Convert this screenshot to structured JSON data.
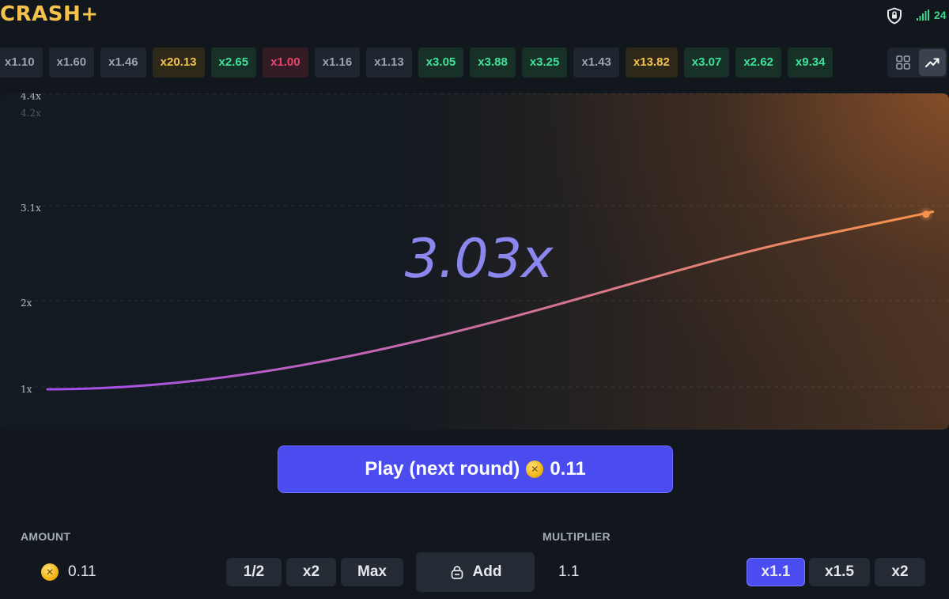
{
  "header": {
    "logo": "CRASH+",
    "ping": "24",
    "icons": {
      "shield": "shield-icon",
      "signal": "signal-bars-icon"
    }
  },
  "history": [
    {
      "label": "x1.10",
      "tone": "grey"
    },
    {
      "label": "x1.60",
      "tone": "grey"
    },
    {
      "label": "x1.46",
      "tone": "grey"
    },
    {
      "label": "x20.13",
      "tone": "gold"
    },
    {
      "label": "x2.65",
      "tone": "green"
    },
    {
      "label": "x1.00",
      "tone": "red"
    },
    {
      "label": "x1.16",
      "tone": "grey"
    },
    {
      "label": "x1.13",
      "tone": "grey"
    },
    {
      "label": "x3.05",
      "tone": "green"
    },
    {
      "label": "x3.88",
      "tone": "green"
    },
    {
      "label": "x3.25",
      "tone": "green"
    },
    {
      "label": "x1.43",
      "tone": "grey"
    },
    {
      "label": "x13.82",
      "tone": "gold"
    },
    {
      "label": "x3.07",
      "tone": "green"
    },
    {
      "label": "x2.62",
      "tone": "green"
    },
    {
      "label": "x9.34",
      "tone": "green"
    }
  ],
  "view_toggle": {
    "grid_icon": "grid-icon",
    "chart_icon": "trend-chart-icon",
    "selected": "chart"
  },
  "game": {
    "current_multiplier": "3.03x",
    "y_ticks": [
      "1x",
      "2x",
      "3.1x",
      "4.2x",
      "4.4x"
    ],
    "y_tick_values": [
      1,
      2,
      3.1,
      4.2,
      4.4
    ],
    "curve_end": 3.03,
    "colors": {
      "curve_start": "#a24df0",
      "curve_end": "#f7934a",
      "accent": "#4a4cf0"
    }
  },
  "play_button": {
    "label": "Play (next round)",
    "amount": "0.11"
  },
  "amount": {
    "label": "AMOUNT",
    "value": "0.11",
    "half": "1/2",
    "double": "x2",
    "max": "Max",
    "add": "Add"
  },
  "multiplier": {
    "label": "MULTIPLIER",
    "value": "1.1",
    "presets": [
      "x1.1",
      "x1.5",
      "x2"
    ],
    "selected": "x1.1"
  }
}
